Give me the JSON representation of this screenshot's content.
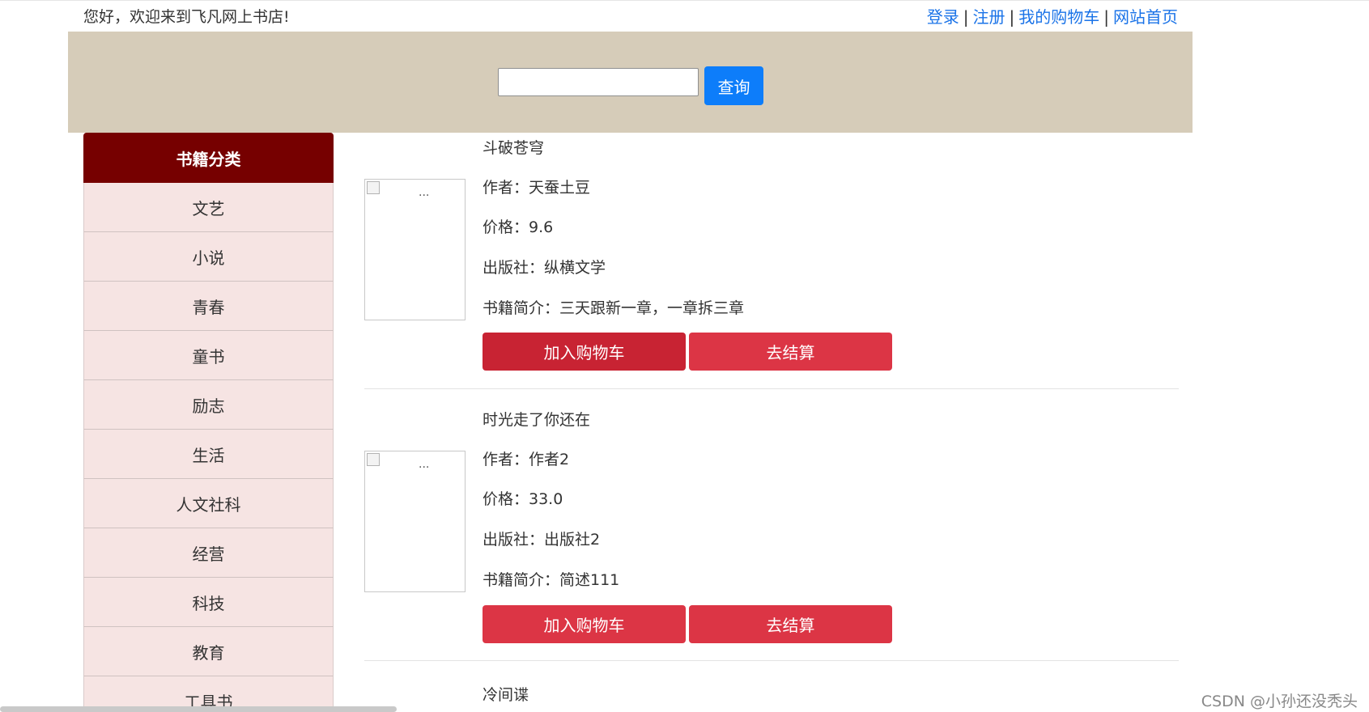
{
  "header": {
    "welcome": "您好，欢迎来到飞凡网上书店!",
    "links": [
      "登录",
      "注册",
      "我的购物车",
      "网站首页"
    ],
    "separator": "|"
  },
  "search": {
    "value": "",
    "button_label": "查询"
  },
  "sidebar": {
    "title": "书籍分类",
    "items": [
      "文艺",
      "小说",
      "青春",
      "童书",
      "励志",
      "生活",
      "人文社科",
      "经营",
      "科技",
      "教育",
      "工具书"
    ]
  },
  "books": [
    {
      "title": "斗破苍穹",
      "author": "作者：天蚕土豆",
      "price": "价格：9.6",
      "publisher": "出版社：纵横文学",
      "intro": "书籍简介：三天跟新一章，一章拆三章",
      "img_alt": "...",
      "add_label": "加入购物车",
      "checkout_label": "去结算"
    },
    {
      "title": "时光走了你还在",
      "author": "作者：作者2",
      "price": "价格：33.0",
      "publisher": "出版社：出版社2",
      "intro": "书籍简介：简述111",
      "img_alt": "...",
      "add_label": "加入购物车",
      "checkout_label": "去结算"
    },
    {
      "title": "冷间谍"
    }
  ],
  "watermark": "CSDN @小孙还没秃头",
  "colors": {
    "banner": "#d6ccb9",
    "sidebar_header": "#760000",
    "sidebar_item": "#f6e4e3",
    "primary": "#0d7dfa",
    "danger": "#dc3545",
    "link": "#1a73e8"
  }
}
